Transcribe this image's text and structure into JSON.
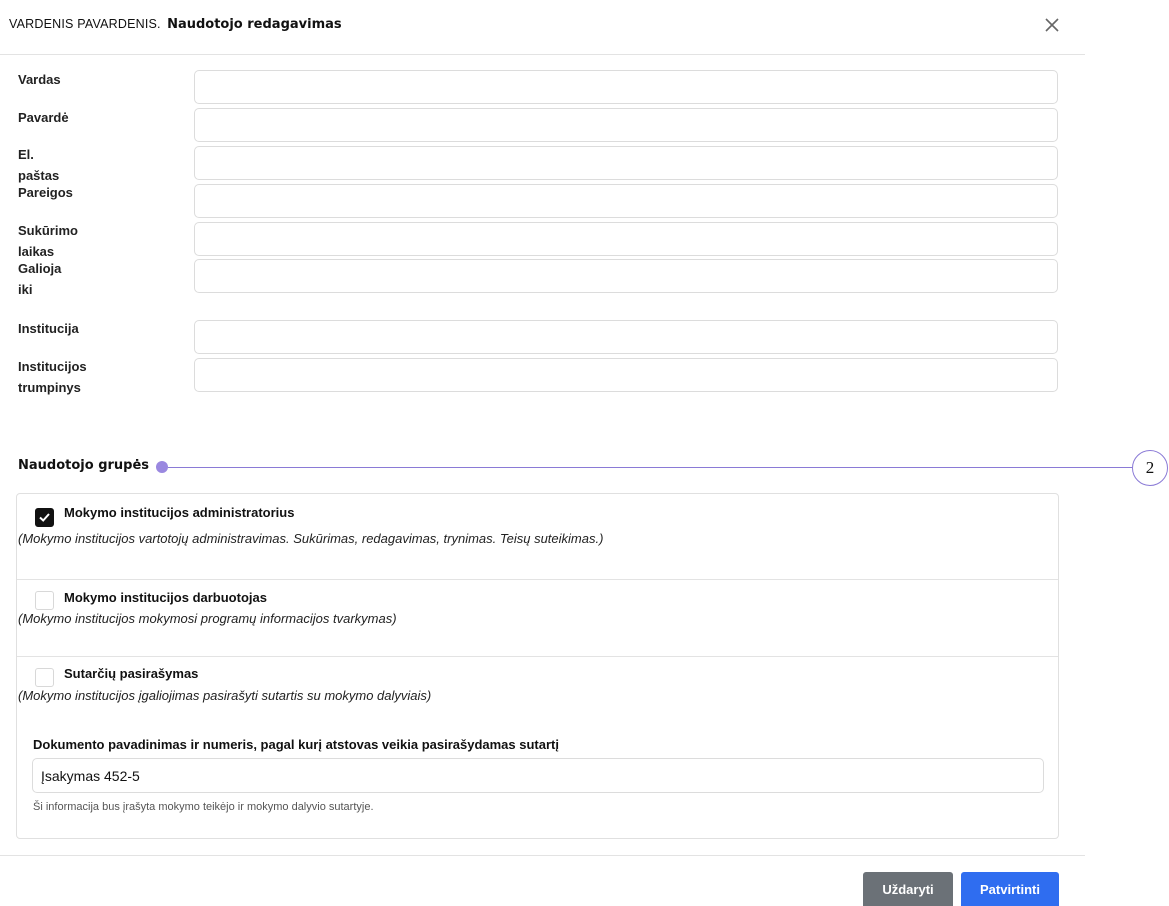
{
  "header": {
    "user_name": "VARDENIS PAVARDENIS.",
    "title": "Naudotojo redagavimas",
    "close_icon": "close-icon"
  },
  "fields": [
    {
      "label": "Vardas",
      "value": ""
    },
    {
      "label": "Pavardė",
      "value": ""
    },
    {
      "label": "El. paštas",
      "value": ""
    },
    {
      "label": "Pareigos",
      "value": ""
    },
    {
      "label": "Sukūrimo laikas",
      "value": ""
    },
    {
      "label": "Galioja iki",
      "value": ""
    },
    {
      "label": "Institucija",
      "value": ""
    },
    {
      "label_line1": "Institucijos",
      "label_line2": "trumpinys",
      "value": ""
    }
  ],
  "groups_section": {
    "title": "Naudotojo grupės",
    "annotation_number": "2",
    "groups": [
      {
        "title": "Mokymo institucijos administratorius",
        "description": "(Mokymo institucijos vartotojų administravimas. Sukūrimas, redagavimas, trynimas. Teisų suteikimas.)",
        "checked": true
      },
      {
        "title": "Mokymo institucijos darbuotojas",
        "description": "(Mokymo institucijos mokymosi programų informacijos tvarkymas)",
        "checked": false
      },
      {
        "title": "Sutarčių pasirašymas",
        "description": "(Mokymo institucijos įgaliojimas pasirašyti sutartis su mokymo dalyviais)",
        "checked": false
      }
    ],
    "document": {
      "label": "Dokumento pavadinimas ir numeris, pagal kurį atstovas veikia pasirašydamas sutartį",
      "value": "Įsakymas 452-5",
      "hint": "Ši informacija bus įrašyta mokymo teikėjo ir mokymo dalyvio sutartyje."
    }
  },
  "footer": {
    "close_label": "Uždaryti",
    "confirm_label": "Patvirtinti",
    "close_color": "#6b7177",
    "confirm_color": "#2f6df0"
  }
}
